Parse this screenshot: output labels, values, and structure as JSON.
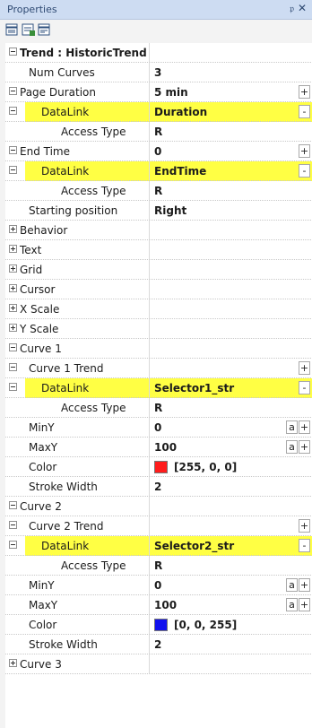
{
  "panel": {
    "title": "Properties",
    "pin_glyph": "ᵖ",
    "close_glyph": "✕"
  },
  "toolbar": {
    "icons": [
      "categorized-view-icon",
      "alphabetical-view-icon",
      "property-pages-icon"
    ]
  },
  "rows": [
    {
      "id": "trend-header",
      "name": "Trend : HistoricTrend",
      "toggle": "minus",
      "indent": 0,
      "header": true
    },
    {
      "id": "num-curves",
      "name": "Num Curves",
      "value": "3",
      "indent": 1
    },
    {
      "id": "page-duration",
      "name": "Page Duration",
      "value": "5 min",
      "toggle": "minus",
      "indent": 0,
      "btns": [
        "+"
      ]
    },
    {
      "id": "page-duration-datalink",
      "name": "DataLink",
      "value": "Duration",
      "toggle": "minus",
      "indent": 2,
      "yellow": true,
      "btns": [
        "-"
      ]
    },
    {
      "id": "page-duration-access",
      "name": "Access Type",
      "value": "R",
      "indent": 3
    },
    {
      "id": "end-time",
      "name": "End Time",
      "value": "0",
      "toggle": "minus",
      "indent": 0,
      "btns": [
        "+"
      ]
    },
    {
      "id": "end-time-datalink",
      "name": "DataLink",
      "value": "EndTime",
      "toggle": "minus",
      "indent": 2,
      "yellow": true,
      "btns": [
        "-"
      ]
    },
    {
      "id": "end-time-access",
      "name": "Access Type",
      "value": "R",
      "indent": 3
    },
    {
      "id": "starting-position",
      "name": "Starting position",
      "value": "Right",
      "indent": 1
    },
    {
      "id": "behavior",
      "name": "Behavior",
      "toggle": "plus",
      "indent": 0
    },
    {
      "id": "text",
      "name": "Text",
      "toggle": "plus",
      "indent": 0
    },
    {
      "id": "grid",
      "name": "Grid",
      "toggle": "plus",
      "indent": 0
    },
    {
      "id": "cursor",
      "name": "Cursor",
      "toggle": "plus",
      "indent": 0
    },
    {
      "id": "x-scale",
      "name": "X Scale",
      "toggle": "plus",
      "indent": 0
    },
    {
      "id": "y-scale",
      "name": "Y Scale",
      "toggle": "plus",
      "indent": 0
    },
    {
      "id": "curve-1",
      "name": "Curve 1",
      "toggle": "minus",
      "indent": 0
    },
    {
      "id": "curve-1-trend",
      "name": "Curve 1 Trend",
      "toggle": "minus",
      "indent": 1,
      "btns": [
        "+"
      ]
    },
    {
      "id": "curve-1-datalink",
      "name": "DataLink",
      "value": "Selector1_str",
      "toggle": "minus",
      "indent": 2,
      "yellow": true,
      "btns": [
        "-"
      ]
    },
    {
      "id": "curve-1-access",
      "name": "Access Type",
      "value": "R",
      "indent": 3
    },
    {
      "id": "curve-1-miny",
      "name": "MinY",
      "value": "0",
      "indent": 1,
      "btns": [
        "a",
        "+"
      ]
    },
    {
      "id": "curve-1-maxy",
      "name": "MaxY",
      "value": "100",
      "indent": 1,
      "btns": [
        "a",
        "+"
      ]
    },
    {
      "id": "curve-1-color",
      "name": "Color",
      "value": "[255, 0, 0]",
      "indent": 1,
      "swatch": "#ff1c1c"
    },
    {
      "id": "curve-1-stroke",
      "name": "Stroke Width",
      "value": "2",
      "indent": 1
    },
    {
      "id": "curve-2",
      "name": "Curve 2",
      "toggle": "minus",
      "indent": 0
    },
    {
      "id": "curve-2-trend",
      "name": "Curve 2 Trend",
      "toggle": "minus",
      "indent": 1,
      "btns": [
        "+"
      ]
    },
    {
      "id": "curve-2-datalink",
      "name": "DataLink",
      "value": "Selector2_str",
      "toggle": "minus",
      "indent": 2,
      "yellow": true,
      "btns": [
        "-"
      ]
    },
    {
      "id": "curve-2-access",
      "name": "Access Type",
      "value": "R",
      "indent": 3
    },
    {
      "id": "curve-2-miny",
      "name": "MinY",
      "value": "0",
      "indent": 1,
      "btns": [
        "a",
        "+"
      ]
    },
    {
      "id": "curve-2-maxy",
      "name": "MaxY",
      "value": "100",
      "indent": 1,
      "btns": [
        "a",
        "+"
      ]
    },
    {
      "id": "curve-2-color",
      "name": "Color",
      "value": "[0, 0, 255]",
      "indent": 1,
      "swatch": "#1111ee"
    },
    {
      "id": "curve-2-stroke",
      "name": "Stroke Width",
      "value": "2",
      "indent": 1
    },
    {
      "id": "curve-3",
      "name": "Curve 3",
      "toggle": "plus",
      "indent": 0
    }
  ],
  "colors": {
    "datalink_highlight": "#ffff44",
    "titlebar": "#cddcf2"
  }
}
